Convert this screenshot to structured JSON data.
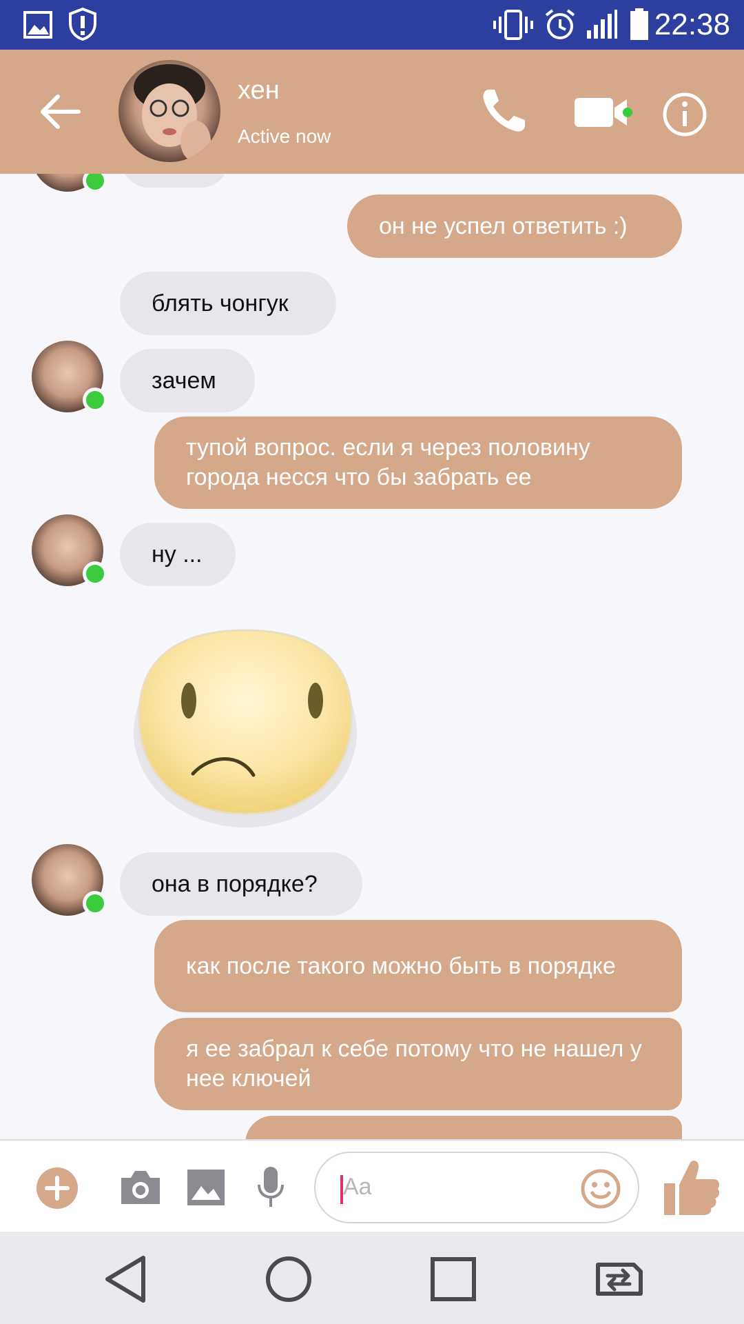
{
  "status_bar": {
    "time": "22:38",
    "icons": [
      "gallery-icon",
      "shield-alert-icon",
      "vibrate-icon",
      "alarm-icon",
      "signal-icon",
      "battery-icon"
    ]
  },
  "header": {
    "contact_name": "хен",
    "status": "Active now",
    "colors": {
      "accent": "#d5a88a",
      "online": "#3ccb3c",
      "status_bar": "#2c3f9e"
    }
  },
  "messages": [
    {
      "sender": "me",
      "text": "он не успел ответить :)"
    },
    {
      "sender": "contact",
      "text": "блять чонгук"
    },
    {
      "sender": "contact",
      "text": "зачем"
    },
    {
      "sender": "me",
      "text": "тупой вопрос. если я через половину города несся что бы забрать ее"
    },
    {
      "sender": "contact",
      "text": "ну ..."
    },
    {
      "sender": "contact",
      "type": "sticker",
      "sticker": "sad-face-sticker"
    },
    {
      "sender": "contact",
      "text": "она в порядке?"
    },
    {
      "sender": "me",
      "text": "как после такого можно быть в порядке"
    },
    {
      "sender": "me",
      "text": "я ее забрал к себе потому что не нашел у нее ключей"
    }
  ],
  "composer": {
    "placeholder": "Aa",
    "icons": [
      "plus-icon",
      "camera-icon",
      "image-icon",
      "microphone-icon",
      "emoji-icon",
      "thumbs-up-icon"
    ]
  },
  "nav_bar": {
    "icons": [
      "back-triangle-icon",
      "home-circle-icon",
      "recents-square-icon",
      "switch-sim-icon"
    ]
  }
}
